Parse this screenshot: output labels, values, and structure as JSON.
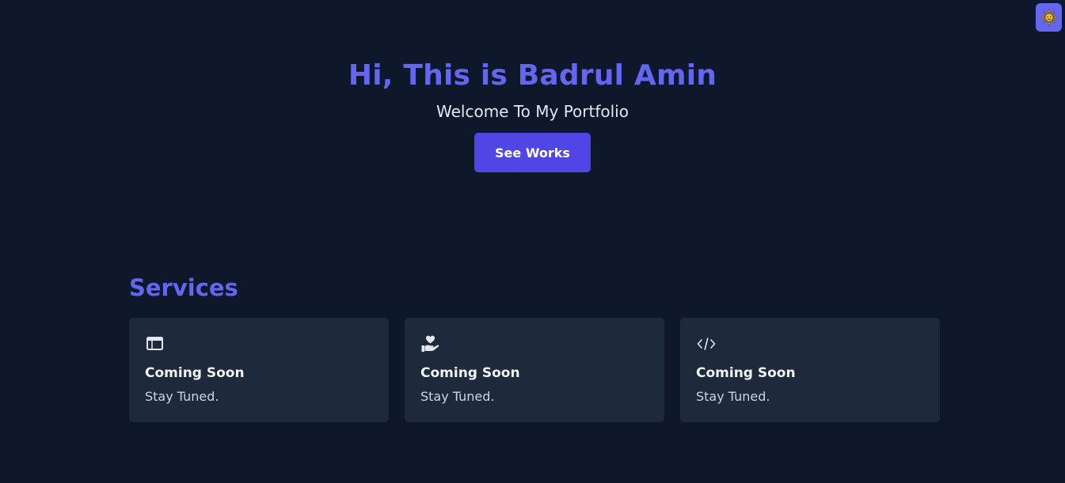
{
  "theme_toggle": {
    "icon": "sun-icon",
    "accent": "#6366f1"
  },
  "hero": {
    "title": "Hi, This is Badrul Amin",
    "subtitle": "Welcome To My Portfolio",
    "button_label": "See Works"
  },
  "services": {
    "title": "Services",
    "cards": [
      {
        "icon": "browser-window-icon",
        "title": "Coming Soon",
        "text": "Stay Tuned."
      },
      {
        "icon": "hand-heart-icon",
        "title": "Coming Soon",
        "text": "Stay Tuned."
      },
      {
        "icon": "code-icon",
        "title": "Coming Soon",
        "text": "Stay Tuned."
      }
    ]
  },
  "colors": {
    "background": "#0f172a",
    "card_background": "#1e293b",
    "accent": "#6366f1",
    "button": "#4f46e5"
  }
}
